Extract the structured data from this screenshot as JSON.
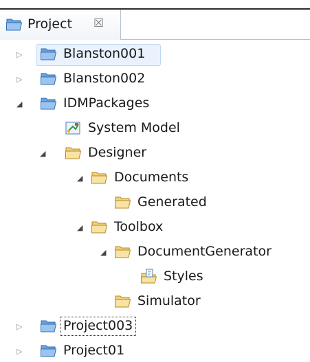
{
  "view": {
    "tab_title": "Project",
    "tab_close_glyph": "☒",
    "tab_icon": "project-folder-icon"
  },
  "tree": [
    {
      "label": "Blanston001",
      "icon": "project-folder-icon",
      "expanded": false,
      "state": "hover"
    },
    {
      "label": "Blanston002",
      "icon": "project-folder-icon",
      "expanded": false
    },
    {
      "label": "IDMPackages",
      "icon": "project-folder-icon",
      "expanded": true
    },
    {
      "label": "System Model",
      "icon": "model-diagram-icon"
    },
    {
      "label": "Designer",
      "icon": "folder-icon",
      "expanded": true
    },
    {
      "label": "Documents",
      "icon": "folder-icon",
      "expanded": true
    },
    {
      "label": "Generated",
      "icon": "folder-icon"
    },
    {
      "label": "Toolbox",
      "icon": "folder-icon",
      "expanded": true
    },
    {
      "label": "DocumentGenerator",
      "icon": "folder-icon",
      "expanded": true
    },
    {
      "label": "Styles",
      "icon": "styles-folder-icon"
    },
    {
      "label": "Simulator",
      "icon": "folder-icon"
    },
    {
      "label": "Project003",
      "icon": "project-folder-icon",
      "expanded": false,
      "state": "focused"
    },
    {
      "label": "Project01",
      "icon": "project-folder-icon",
      "expanded": false
    }
  ],
  "colors": {
    "project_folder": "#4f8fd6",
    "folder": "#e6c56a",
    "hover_bg": "#eaf3fd",
    "hover_border": "#bcd9f8"
  }
}
